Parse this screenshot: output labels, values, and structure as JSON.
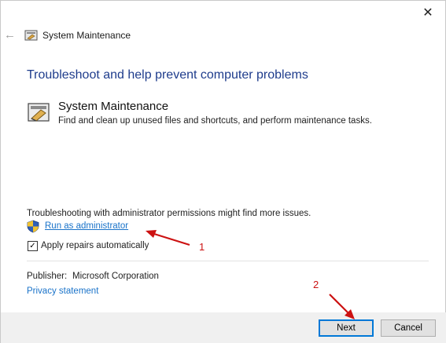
{
  "window": {
    "close_glyph": "✕",
    "back_glyph": "←"
  },
  "nav": {
    "title": "System Maintenance"
  },
  "main": {
    "heading": "Troubleshoot and help prevent computer problems",
    "task_title": "System Maintenance",
    "task_description": "Find and clean up unused files and shortcuts, and perform maintenance tasks.",
    "admin_note": "Troubleshooting with administrator permissions might find more issues.",
    "run_as_admin": "Run as administrator",
    "apply_repairs": {
      "label": "Apply repairs automatically",
      "checked": true,
      "check_glyph": "✓"
    },
    "publisher_label": "Publisher:",
    "publisher_value": "Microsoft Corporation",
    "privacy_link": "Privacy statement"
  },
  "footer": {
    "next_label": "Next",
    "cancel_label": "Cancel"
  },
  "annotations": {
    "label_1": "1",
    "label_2": "2",
    "color": "#cc1111"
  },
  "colors": {
    "heading": "#1e3c8c",
    "link": "#1a73c9",
    "footer_bg": "#f0f0f0",
    "focus_border": "#0078d7"
  },
  "icons": {
    "nav": "system-maintenance-icon",
    "task": "system-maintenance-icon",
    "admin": "uac-shield-icon"
  }
}
